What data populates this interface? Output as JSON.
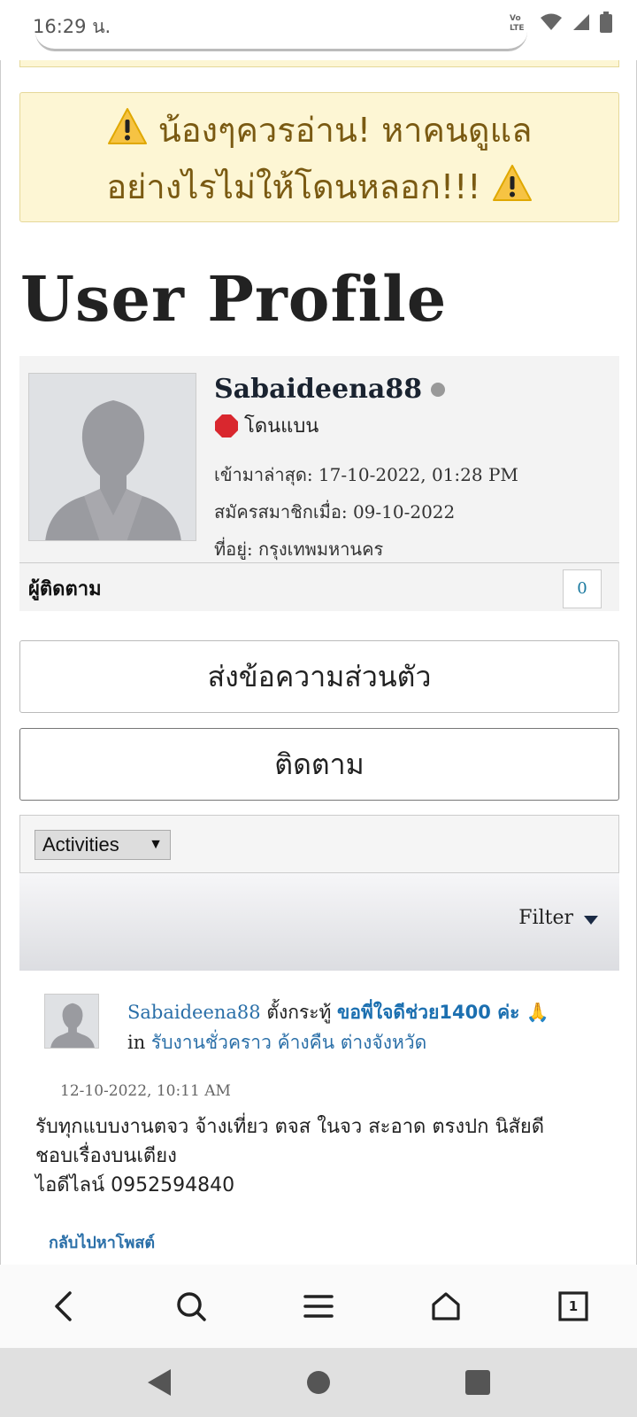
{
  "status_bar": {
    "time": "16:29 น."
  },
  "warning": {
    "line1": "น้องๆควรอ่าน! หาคนดูแล",
    "line2": "อย่างไรไม่ให้โดนหลอก!!!"
  },
  "page_title": "User Profile",
  "profile": {
    "username": "Sabaideena88",
    "ban_status": "โดนแบน",
    "last_seen": "เข้ามาล่าสุด: 17-10-2022, 01:28 PM",
    "joined": "สมัครสมาชิกเมื่อ: 09-10-2022",
    "location": "ที่อยู่: กรุงเทพมหานคร",
    "followers_label": "ผู้ติดตาม",
    "followers_count": "0"
  },
  "buttons": {
    "private_message": "ส่งข้อความส่วนตัว",
    "follow": "ติดตาม"
  },
  "activities": {
    "select_value": "Activities",
    "filter_label": "Filter"
  },
  "activity_item": {
    "author": "Sabaideena88",
    "action": " ตั้งกระทู้ ",
    "thread_title": "ขอพี่ใจดีช่วย1400 ค่ะ 🙏",
    "in_label": "in ",
    "forum": "รับงานชั่วคราว ค้างคืน ต่างจังหวัด",
    "timestamp": "12-10-2022, 10:11 AM",
    "body_line1": "รับทุกแบบงานตจว จ้างเที่ยว ตจส ในจว สะอาด ตรงปก นิสัยดี",
    "body_line2": "ชอบเรื่องบนเตียง",
    "body_line3": "ไอดีไลน์ 0952594840",
    "back_link": "กลับไปหาโพสต์"
  },
  "toolbar": {
    "tab_count": "1"
  },
  "icons": {
    "warning": "warning-icon",
    "stop": "stop-sign-icon",
    "back": "chevron-left-icon",
    "search": "search-icon",
    "menu": "menu-icon",
    "home": "home-icon",
    "tabs": "tabs-icon"
  }
}
